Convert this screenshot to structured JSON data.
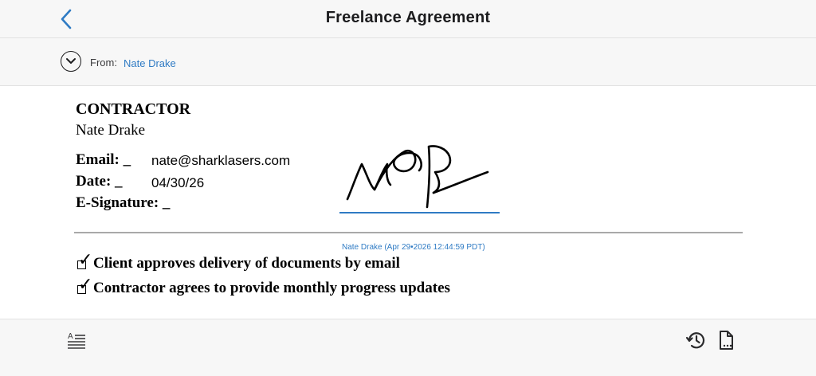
{
  "nav": {
    "title": "Freelance Agreement"
  },
  "from": {
    "label": "From:",
    "name": "Nate Drake"
  },
  "document": {
    "heading": "CONTRACTOR",
    "name": "Nate Drake",
    "fields": [
      {
        "label": "Email: _",
        "value": "nate@sharklasers.com"
      },
      {
        "label": "Date: _",
        "value": "04/30/26"
      },
      {
        "label": "E-Signature: _",
        "value": ""
      }
    ],
    "signature_stamp": "Nate Drake (Apr 29•2026 12:44:59 PDT)",
    "checkboxes": [
      {
        "label": "Client approves delivery of documents by email",
        "checked": true
      },
      {
        "label": "Contractor agrees to provide monthly progress updates",
        "checked": true
      }
    ]
  },
  "colors": {
    "accent": "#2f7bc4",
    "bar_background": "#f7f7f7",
    "divider": "#a9a9a9"
  },
  "icons": {
    "back": "chevron-left-icon",
    "expand": "chevron-down-icon",
    "text_format": "text-format-icon",
    "history": "history-icon",
    "document": "document-icon"
  }
}
